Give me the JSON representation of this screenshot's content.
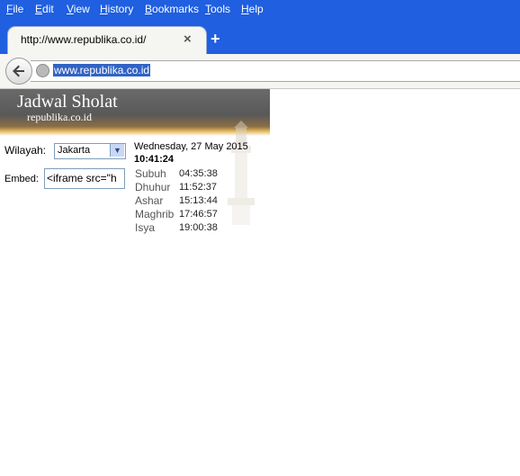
{
  "menu": [
    "File",
    "Edit",
    "View",
    "History",
    "Bookmarks",
    "Tools",
    "Help"
  ],
  "tab": {
    "title": "http://www.republika.co.id/",
    "close": "×",
    "new_tab": "+"
  },
  "nav": {
    "url": "www.republika.co.id"
  },
  "widget": {
    "title": "Jadwal Sholat",
    "subtitle": "republika.co.id",
    "wilayah_label": "Wilayah:",
    "wilayah_value": "Jakarta",
    "embed_label": "Embed:",
    "embed_value": "<iframe src=\"h",
    "date": "Wednesday, 27 May 2015",
    "time": "10:41:24",
    "prayers": [
      {
        "name": "Subuh",
        "time": "04:35:38"
      },
      {
        "name": "Dhuhur",
        "time": "11:52:37"
      },
      {
        "name": "Ashar",
        "time": "15:13:44"
      },
      {
        "name": "Maghrib",
        "time": "17:46:57"
      },
      {
        "name": "Isya",
        "time": "19:00:38"
      }
    ]
  },
  "colors": {
    "chrome_blue": "#1f5fe0",
    "url_highlight": "#3163c5"
  },
  "icons": [
    "back-arrow-icon",
    "globe-icon",
    "dropdown-arrow-icon",
    "minaret-image"
  ]
}
